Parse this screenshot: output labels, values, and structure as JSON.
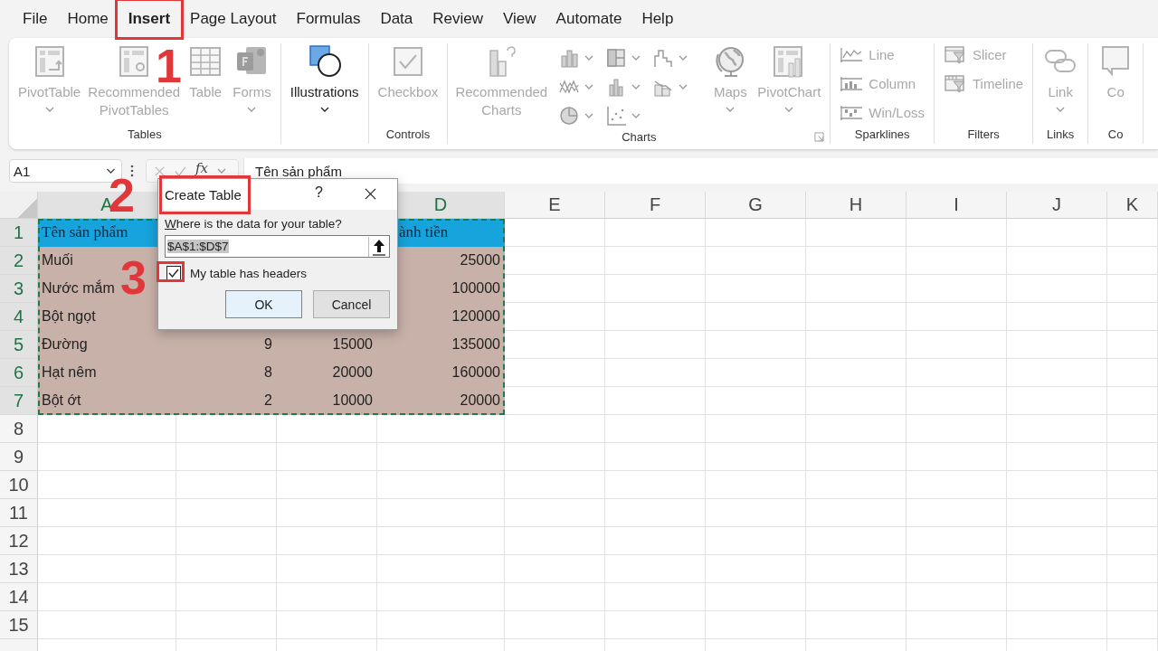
{
  "menu_tabs": [
    {
      "label": "File",
      "selected": false,
      "highlighted": false
    },
    {
      "label": "Home",
      "selected": false,
      "highlighted": false
    },
    {
      "label": "Insert",
      "selected": true,
      "highlighted": true
    },
    {
      "label": "Page Layout",
      "selected": false,
      "highlighted": false
    },
    {
      "label": "Formulas",
      "selected": false,
      "highlighted": false
    },
    {
      "label": "Data",
      "selected": false,
      "highlighted": false
    },
    {
      "label": "Review",
      "selected": false,
      "highlighted": false
    },
    {
      "label": "View",
      "selected": false,
      "highlighted": false
    },
    {
      "label": "Automate",
      "selected": false,
      "highlighted": false
    },
    {
      "label": "Help",
      "selected": false,
      "highlighted": false
    }
  ],
  "ribbon_groups": [
    {
      "label": "Tables",
      "commands": [
        {
          "kind": "large",
          "label": "PivotTable",
          "disabled": true,
          "dropdown": true
        },
        {
          "kind": "large",
          "label": "Recommended PivotTables",
          "disabled": true,
          "dropdown": false
        },
        {
          "kind": "large",
          "label": "Table",
          "disabled": true,
          "dropdown": false
        },
        {
          "kind": "large",
          "label": "Forms",
          "disabled": true,
          "dropdown": true
        }
      ]
    },
    {
      "commands": [
        {
          "kind": "large",
          "label": "Illustrations",
          "disabled": false,
          "dropdown": true
        }
      ]
    },
    {
      "label": "Controls",
      "commands": [
        {
          "kind": "large",
          "label": "Checkbox",
          "disabled": true,
          "dropdown": false
        }
      ]
    },
    {
      "label": "Charts",
      "dialog_launcher": true,
      "commands": [
        {
          "kind": "large",
          "label": "Recommended Charts",
          "disabled": true,
          "dropdown": false
        },
        {
          "kind": "icon",
          "disabled": true,
          "dropdown": true
        },
        {
          "kind": "icon",
          "disabled": true,
          "dropdown": true
        },
        {
          "kind": "icon",
          "disabled": true,
          "dropdown": true
        },
        {
          "kind": "icon",
          "disabled": true,
          "dropdown": true
        },
        {
          "kind": "icon",
          "disabled": true,
          "dropdown": true
        },
        {
          "kind": "icon",
          "disabled": true,
          "dropdown": true
        },
        {
          "kind": "icon",
          "disabled": true,
          "dropdown": true
        },
        {
          "kind": "icon",
          "disabled": true,
          "dropdown": true
        },
        {
          "kind": "large",
          "label": "Maps",
          "disabled": true,
          "dropdown": true
        },
        {
          "kind": "large",
          "label": "PivotChart",
          "disabled": true,
          "dropdown": true
        }
      ]
    },
    {
      "label": "Sparklines",
      "commands": [
        {
          "kind": "small",
          "label": "Line",
          "disabled": true
        },
        {
          "kind": "small",
          "label": "Column",
          "disabled": true
        },
        {
          "kind": "small",
          "label": "Win/Loss",
          "disabled": true
        }
      ]
    },
    {
      "label": "Filters",
      "commands": [
        {
          "kind": "small",
          "label": "Slicer",
          "disabled": true
        },
        {
          "kind": "small",
          "label": "Timeline",
          "disabled": true
        }
      ]
    },
    {
      "label": "Links",
      "commands": [
        {
          "kind": "large",
          "label": "Link",
          "disabled": true,
          "dropdown": true
        }
      ]
    },
    {
      "label": "Co",
      "commands": [
        {
          "kind": "large",
          "label": "Co",
          "disabled": true,
          "dropdown": false
        }
      ]
    }
  ],
  "formula_bar": {
    "name_box": "A1",
    "function_label": "fx",
    "formula": "Tên sản phẩm"
  },
  "sheet": {
    "columns": [
      {
        "label": "A",
        "selected": true
      },
      {},
      {},
      {
        "label": "D",
        "selected": true
      },
      {
        "label": "E",
        "selected": false
      },
      {
        "label": "F",
        "selected": false
      },
      {
        "label": "G",
        "selected": false
      },
      {
        "label": "H",
        "selected": false
      },
      {
        "label": "I",
        "selected": false
      },
      {
        "label": "J",
        "selected": false
      },
      {
        "label": "K",
        "selected": false
      }
    ],
    "rows": [
      {
        "label": "1",
        "selected": true,
        "kind": "header",
        "cells": {
          "A": "Tên sản phẩm",
          "D": "ành tiền"
        }
      },
      {
        "label": "2",
        "selected": true,
        "kind": "body",
        "cells": {
          "A": "Muối",
          "D": "25000"
        }
      },
      {
        "label": "3",
        "selected": true,
        "kind": "body",
        "cells": {
          "A": "Nước mắm",
          "D": "100000"
        }
      },
      {
        "label": "4",
        "selected": true,
        "kind": "body",
        "cells": {
          "A": "Bột ngọt",
          "D": "120000"
        }
      },
      {
        "label": "5",
        "selected": true,
        "kind": "body",
        "cells": {
          "A": "Đường",
          "B": "9",
          "C": "15000",
          "D": "135000"
        }
      },
      {
        "label": "6",
        "selected": true,
        "kind": "body",
        "cells": {
          "A": "Hạt nêm",
          "B": "8",
          "C": "20000",
          "D": "160000"
        }
      },
      {
        "label": "7",
        "selected": true,
        "kind": "body",
        "cells": {
          "A": "Bột ớt",
          "B": "2",
          "C": "10000",
          "D": "20000"
        }
      },
      {
        "label": "8",
        "selected": false,
        "kind": "empty"
      },
      {
        "label": "9",
        "selected": false,
        "kind": "empty"
      },
      {
        "label": "10",
        "selected": false,
        "kind": "empty"
      },
      {
        "label": "11",
        "selected": false,
        "kind": "empty"
      },
      {
        "label": "12",
        "selected": false,
        "kind": "empty"
      },
      {
        "label": "13",
        "selected": false,
        "kind": "empty"
      },
      {
        "label": "14",
        "selected": false,
        "kind": "empty"
      },
      {
        "label": "15",
        "selected": false,
        "kind": "empty"
      },
      {
        "kind": "empty"
      }
    ]
  },
  "dialog": {
    "title": "Create Table",
    "title_highlighted": true,
    "help_label": "?",
    "prompt": "Where is the data for your table?",
    "range": "$A$1:$D$7",
    "range_selected": true,
    "headers_option": {
      "label": "My table has headers",
      "checked": true,
      "highlighted": true
    },
    "buttons": [
      {
        "label": "OK",
        "default": true
      },
      {
        "label": "Cancel",
        "default": false
      }
    ]
  },
  "step_markers": [
    {
      "label": "1"
    },
    {
      "label": "2"
    },
    {
      "label": "3"
    }
  ]
}
